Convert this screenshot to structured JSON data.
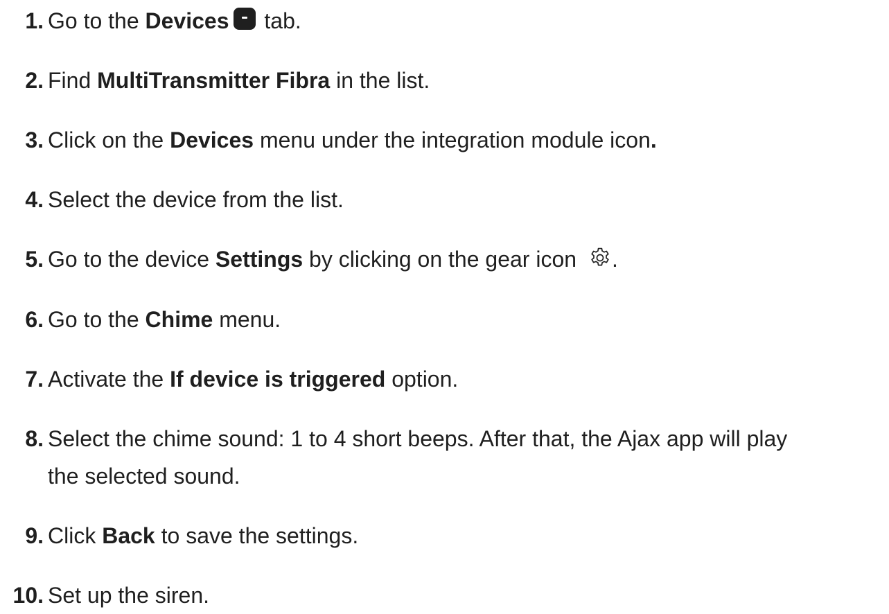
{
  "steps": [
    {
      "num": "1.",
      "pre": "Go to the ",
      "bold": "Devices",
      "post": " tab.",
      "icon": "devices-tab-icon"
    },
    {
      "num": "2.",
      "pre": "Find ",
      "bold": "MultiTransmitter Fibra",
      "post": " in the list."
    },
    {
      "num": "3.",
      "pre": "Click on the ",
      "bold": "Devices",
      "post": " menu under the integration module icon",
      "post_bold": "."
    },
    {
      "num": "4.",
      "text": "Select the device from the list."
    },
    {
      "num": "5.",
      "pre": "Go to the device ",
      "bold": "Settings",
      "post": " by clicking on the gear icon ",
      "post2": ".",
      "icon": "gear-icon"
    },
    {
      "num": "6.",
      "pre": "Go to the ",
      "bold": "Chime",
      "post": " menu."
    },
    {
      "num": "7.",
      "pre": "Activate the ",
      "bold": "If device is triggered",
      "post": " option."
    },
    {
      "num": "8.",
      "line1": "Select the chime sound: 1 to 4 short beeps. After that, the Ajax app will play",
      "line2": "the selected sound."
    },
    {
      "num": "9.",
      "pre": "Click ",
      "bold": "Back",
      "post": " to save the settings."
    },
    {
      "num": "10.",
      "text": "Set up the siren."
    }
  ]
}
